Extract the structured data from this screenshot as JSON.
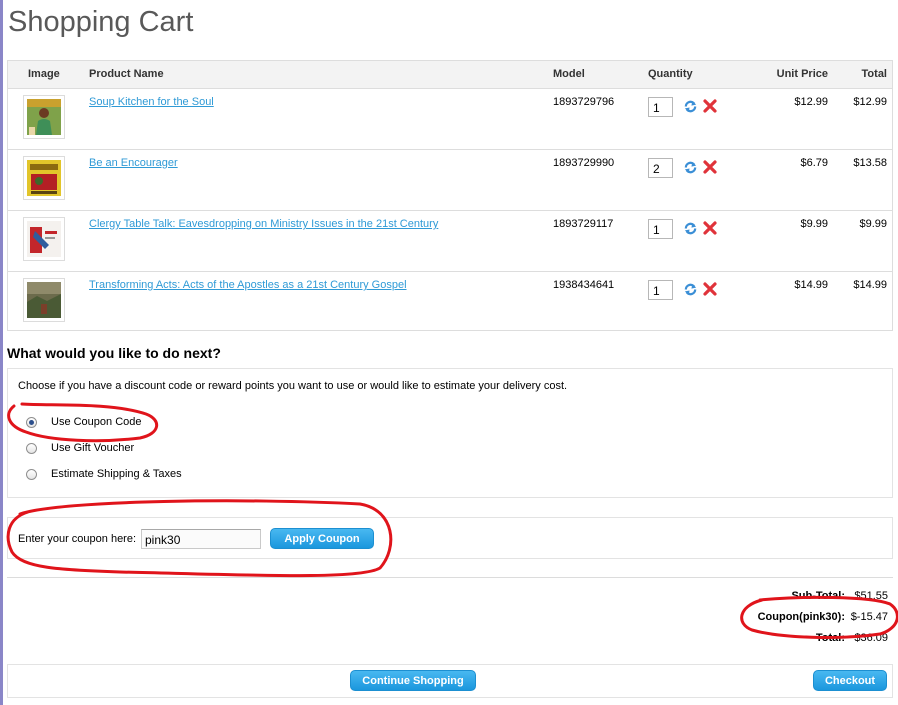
{
  "page": {
    "title": "Shopping Cart"
  },
  "cart": {
    "headers": {
      "image": "Image",
      "product": "Product Name",
      "model": "Model",
      "quantity": "Quantity",
      "unit_price": "Unit Price",
      "total": "Total"
    },
    "items": [
      {
        "name": "Soup Kitchen for the Soul",
        "model": "1893729796",
        "qty": "1",
        "unit_price": "$12.99",
        "total": "$12.99"
      },
      {
        "name": "Be an Encourager",
        "model": "1893729990",
        "qty": "2",
        "unit_price": "$6.79",
        "total": "$13.58"
      },
      {
        "name": "Clergy Table Talk: Eavesdropping on Ministry Issues in the 21st Century",
        "model": "1893729117",
        "qty": "1",
        "unit_price": "$9.99",
        "total": "$9.99"
      },
      {
        "name": "Transforming Acts: Acts of the Apostles as a 21st Century Gospel",
        "model": "1938434641",
        "qty": "1",
        "unit_price": "$14.99",
        "total": "$14.99"
      }
    ],
    "icons": {
      "update": "refresh-icon",
      "remove": "remove-icon"
    }
  },
  "next": {
    "heading": "What would you like to do next?",
    "description": "Choose if you have a discount code or reward points you want to use or would like to estimate your delivery cost.",
    "options": [
      {
        "label": "Use Coupon Code",
        "selected": true
      },
      {
        "label": "Use Gift Voucher",
        "selected": false
      },
      {
        "label": "Estimate Shipping & Taxes",
        "selected": false
      }
    ]
  },
  "coupon": {
    "label": "Enter your coupon here:",
    "value": "pink30",
    "button": "Apply Coupon"
  },
  "totals": {
    "subtotal_label": "Sub-Total:",
    "subtotal": "$51.55",
    "coupon_label": "Coupon(pink30):",
    "coupon": "$-15.47",
    "total_label": "Total:",
    "total": "$36.09"
  },
  "actions": {
    "continue": "Continue Shopping",
    "checkout": "Checkout"
  },
  "colors": {
    "link": "#2f9ad6",
    "button": "#1b97dd",
    "annotation": "#e0141b"
  }
}
